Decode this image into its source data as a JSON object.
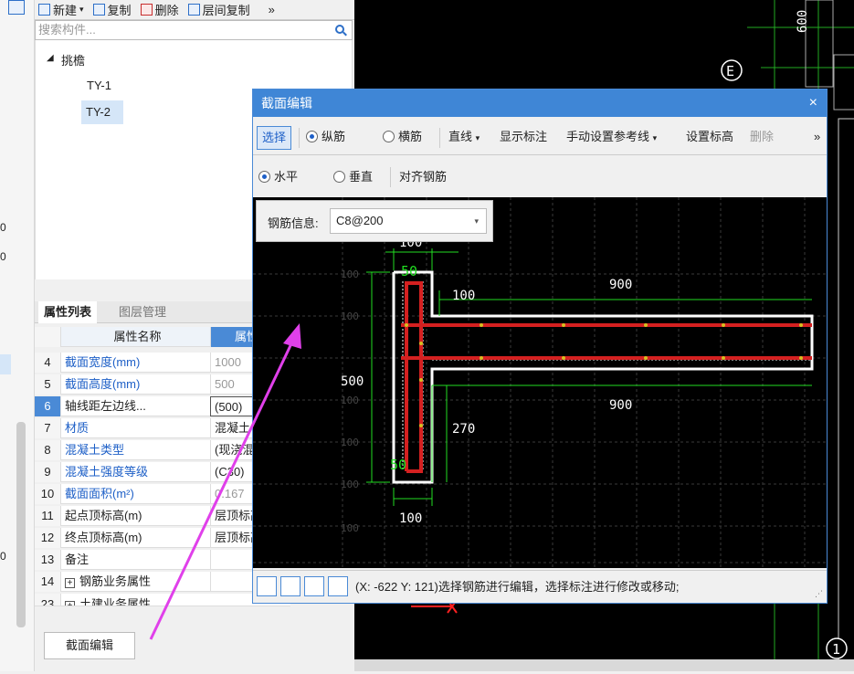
{
  "component_toolbar": {
    "new_label": "新建",
    "copy_label": "复制",
    "delete_label": "删除",
    "floor_copy_label": "层间复制",
    "more_label": "»"
  },
  "search": {
    "placeholder": "搜索构件..."
  },
  "tree": {
    "group_label": "挑檐",
    "items": [
      "TY-1",
      "TY-2"
    ],
    "selected": "TY-2"
  },
  "left_strip": {
    "values": [
      "0",
      "0",
      "0"
    ]
  },
  "properties": {
    "tab_list": "属性列表",
    "tab_layers": "图层管理",
    "header_name": "属性名称",
    "header_value": "属性值",
    "rows": [
      {
        "no": "4",
        "name": "截面宽度(mm)",
        "value": "1000"
      },
      {
        "no": "5",
        "name": "截面高度(mm)",
        "value": "500"
      },
      {
        "no": "6",
        "name": "轴线距左边线...",
        "value": "(500)"
      },
      {
        "no": "7",
        "name": "材质",
        "value": "混凝土"
      },
      {
        "no": "8",
        "name": "混凝土类型",
        "value": "(现浇混凝土"
      },
      {
        "no": "9",
        "name": "混凝土强度等级",
        "value": "(C30)"
      },
      {
        "no": "10",
        "name": "截面面积(m²)",
        "value": "0.167"
      },
      {
        "no": "11",
        "name": "起点顶标高(m)",
        "value": "层顶标高"
      },
      {
        "no": "12",
        "name": "终点顶标高(m)",
        "value": "层顶标高"
      },
      {
        "no": "13",
        "name": "备注",
        "value": ""
      },
      {
        "no": "14",
        "name": "钢筋业务属性",
        "value": ""
      },
      {
        "no": "23",
        "name": "土建业务属性",
        "value": ""
      }
    ],
    "section_edit_button": "截面编辑"
  },
  "cad_background": {
    "dim_label": "600",
    "axis_e": "E",
    "axis_1": "1"
  },
  "dialog": {
    "title": "截面编辑",
    "close": "×",
    "toolbar1": {
      "select": "选择",
      "longitudinal": "纵筋",
      "transverse": "横筋",
      "line": "直线",
      "show_dim": "显示标注",
      "manual_ref": "手动设置参考线",
      "set_elev": "设置标高",
      "delete": "删除",
      "more": "»"
    },
    "toolbar2": {
      "horizontal": "水平",
      "vertical": "垂直",
      "align": "对齐钢筋"
    },
    "rebar_info": {
      "label": "钢筋信息:",
      "value": "C8@200"
    },
    "drawing": {
      "dims": {
        "top_width": "900",
        "bottom_width": "900",
        "left_height": "500",
        "wall_width_top": "100",
        "slab_thick": "100",
        "lower_height": "270",
        "bottom_width_small": "100",
        "corner_top": "50",
        "corner_bottom": "50",
        "grid_lbl": "100"
      }
    },
    "status": "(X: -622 Y: 121)选择钢筋进行编辑，选择标注进行修改或移动;"
  },
  "colors": {
    "accent": "#3f86d6",
    "rebar": "#d42020",
    "dim": "#22dd22",
    "concrete": "#ffffff",
    "arrow": "#e040ea"
  }
}
